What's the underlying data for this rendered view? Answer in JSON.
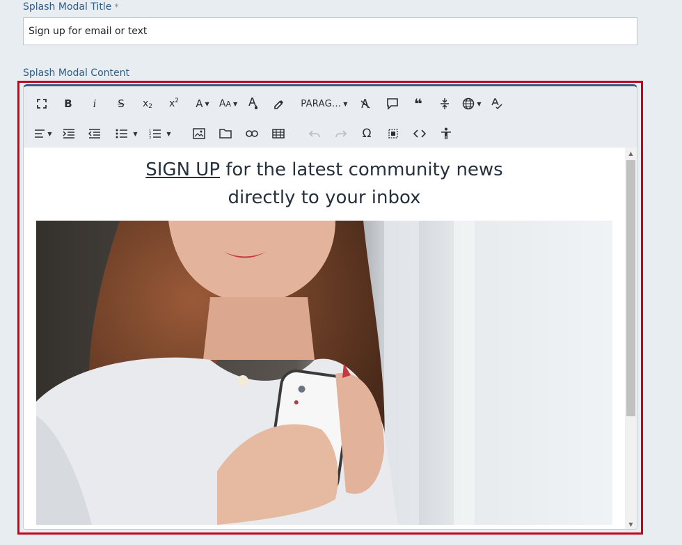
{
  "form": {
    "title_label": "Splash Modal Title",
    "required_mark": "*",
    "title_value": "Sign up for email or text",
    "content_label": "Splash Modal Content"
  },
  "toolbar": {
    "row1": [
      {
        "name": "fullscreen-icon",
        "glyph": "⛶"
      },
      {
        "name": "bold-icon",
        "glyph": "B"
      },
      {
        "name": "italic-icon",
        "glyph": "i"
      },
      {
        "name": "strikethrough-icon",
        "glyph": "S"
      },
      {
        "name": "subscript-icon",
        "glyph": "x₂"
      },
      {
        "name": "superscript-icon",
        "glyph": "x²"
      },
      {
        "name": "font-family-icon",
        "glyph": "A"
      },
      {
        "name": "font-size-icon",
        "glyph": "AA"
      },
      {
        "name": "text-color-icon",
        "glyph": "A"
      },
      {
        "name": "highlight-icon",
        "glyph": "✎"
      },
      {
        "name": "paragraph-format-dropdown",
        "glyph": "PARAG..."
      },
      {
        "name": "clear-formatting-icon",
        "glyph": "A"
      },
      {
        "name": "comment-icon",
        "glyph": "▭"
      },
      {
        "name": "quote-icon",
        "glyph": "❝"
      },
      {
        "name": "line-height-icon",
        "glyph": "↕"
      },
      {
        "name": "language-icon",
        "glyph": "⊕"
      },
      {
        "name": "spellcheck-icon",
        "glyph": "A"
      }
    ],
    "paragraph_label": "PARAG...",
    "row2_note": "alignment, indentation, lists, media, table, undo/redo, special characters, select all, code view, accessibility"
  },
  "content": {
    "headline_link": "SIGN UP",
    "headline_rest": " for the latest community news",
    "headline_line2": "directly to your inbox"
  },
  "colors": {
    "label": "#2f5d86",
    "highlight_frame": "#c0061b",
    "toolbar_bg": "#e9edf1",
    "page_bg": "#e8edf2",
    "text": "#26313d"
  }
}
